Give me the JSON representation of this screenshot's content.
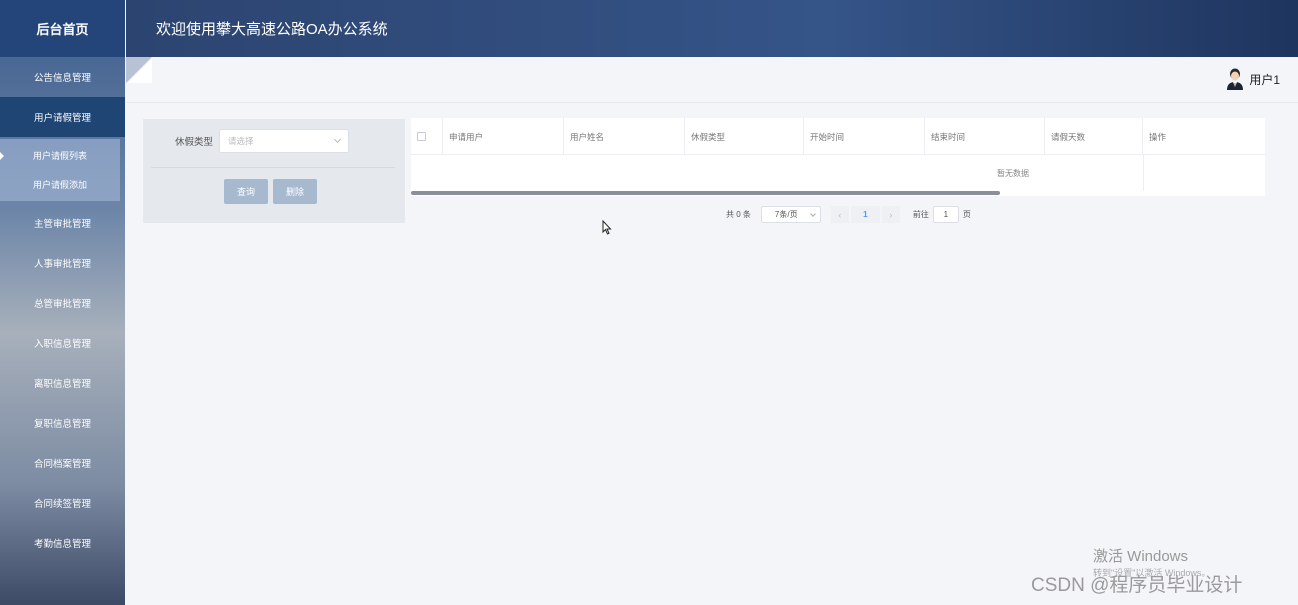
{
  "sidebar": {
    "brand": "后台首页",
    "items": [
      {
        "label": "公告信息管理"
      },
      {
        "label": "用户请假管理"
      },
      {
        "label": "主管审批管理"
      },
      {
        "label": "人事审批管理"
      },
      {
        "label": "总管审批管理"
      },
      {
        "label": "入职信息管理"
      },
      {
        "label": "离职信息管理"
      },
      {
        "label": "复职信息管理"
      },
      {
        "label": "合同档案管理"
      },
      {
        "label": "合同续签管理"
      },
      {
        "label": "考勤信息管理"
      }
    ],
    "submenu": [
      {
        "label": "用户请假列表"
      },
      {
        "label": "用户请假添加"
      }
    ],
    "active_index": 1
  },
  "header": {
    "title": "欢迎使用攀大高速公路OA办公系统"
  },
  "user": {
    "name": "用户1"
  },
  "search": {
    "field_label": "休假类型",
    "select_placeholder": "请选择",
    "query_button": "查询",
    "delete_button": "删除"
  },
  "table": {
    "columns": [
      "申请用户",
      "用户姓名",
      "休假类型",
      "开始时间",
      "结束时间",
      "请假天数",
      "操作"
    ],
    "empty_text": "暂无数据"
  },
  "pagination": {
    "total": "共 0 条",
    "page_size": "7条/页",
    "prev": "‹",
    "current_page": "1",
    "next": "›",
    "goto_label": "前往",
    "goto_value": "1",
    "page_unit": "页"
  },
  "watermark": {
    "activate": "激活 Windows",
    "activate_sub": "转到\"设置\"以激活 Windows。",
    "csdn": "CSDN @程序员毕业设计"
  }
}
